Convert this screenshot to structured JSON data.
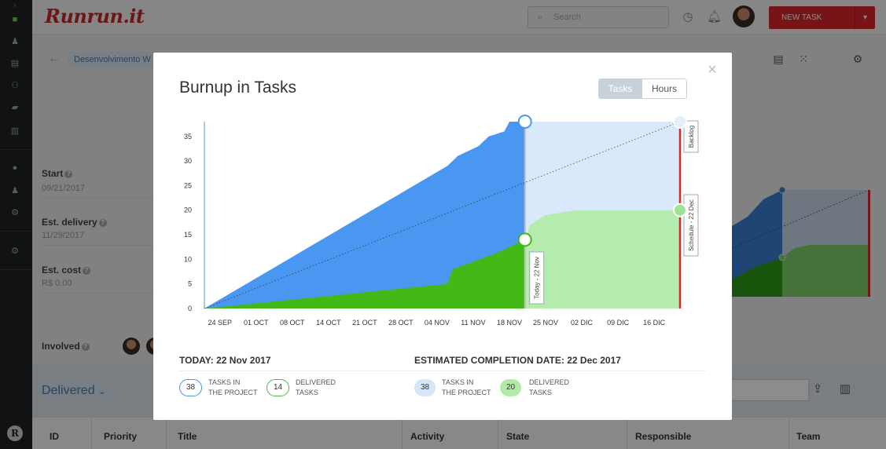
{
  "app": {
    "brand": "Runrun.it",
    "search_placeholder": "Search",
    "new_task_label": "NEW TASK"
  },
  "page": {
    "project_chip": "Desenvolvimento W",
    "start_label": "Start",
    "start_value": "09/21/2017",
    "est_delivery_label": "Est. delivery",
    "est_delivery_value": "11/29/2017",
    "est_cost_label": "Est. cost",
    "est_cost_value": "R$ 0.00",
    "involved_label": "Involved",
    "delivered_title": "Delivered",
    "table_headers": [
      "ID",
      "Priority",
      "Title",
      "Activity",
      "State",
      "Responsible",
      "Team"
    ]
  },
  "modal": {
    "title": "Burnup in Tasks",
    "toggle": {
      "tasks_label": "Tasks",
      "hours_label": "Hours",
      "selected": "Tasks"
    },
    "today_heading": "TODAY: 22 Nov 2017",
    "estimate_heading": "ESTIMATED COMPLETION DATE: 22 Dec 2017",
    "today_stats": [
      {
        "value": "38",
        "label_line1": "TASKS IN",
        "label_line2": "THE PROJECT"
      },
      {
        "value": "14",
        "label_line1": "DELIVERED",
        "label_line2": "TASKS"
      }
    ],
    "estimate_stats": [
      {
        "value": "38",
        "label_line1": "TASKS IN",
        "label_line2": "THE PROJECT"
      },
      {
        "value": "20",
        "label_line1": "DELIVERED",
        "label_line2": "TASKS"
      }
    ]
  },
  "chart_data": {
    "type": "area",
    "title": "Burnup in Tasks",
    "ylim": [
      0,
      38
    ],
    "yticks": [
      0,
      5,
      10,
      15,
      20,
      25,
      30,
      35
    ],
    "x_tick_labels": [
      "24 SEP",
      "01 OCT",
      "08 OCT",
      "14 OCT",
      "21 OCT",
      "28 OCT",
      "04 NOV",
      "11 NOV",
      "18 NOV",
      "25 NOV",
      "02 DIC",
      "09 DIC",
      "16 DIC"
    ],
    "x_start": "2017-09-21",
    "x_end": "2017-12-22",
    "markers": [
      {
        "date": "2017-11-22",
        "label": "Today - 22 Nov"
      },
      {
        "date": "2017-12-22",
        "label": "Schedule - 22 Dec"
      }
    ],
    "backlog_label": "Backlog",
    "colors": {
      "scope": "#4a97f2",
      "delivered": "#43b917",
      "scope_projection": "#d9e9fb",
      "delivered_projection": "#b3ecac",
      "deadline": "#d9262c"
    },
    "series": [
      {
        "name": "Tasks in the project",
        "points": [
          [
            "2017-09-21",
            0
          ],
          [
            "2017-11-07",
            29
          ],
          [
            "2017-11-09",
            31
          ],
          [
            "2017-11-13",
            33
          ],
          [
            "2017-11-15",
            35
          ],
          [
            "2017-11-18",
            36
          ],
          [
            "2017-11-19",
            38
          ],
          [
            "2017-11-22",
            38
          ]
        ]
      },
      {
        "name": "Delivered tasks",
        "points": [
          [
            "2017-09-21",
            0
          ],
          [
            "2017-11-07",
            5
          ],
          [
            "2017-11-08",
            8
          ],
          [
            "2017-11-12",
            9.5
          ],
          [
            "2017-11-17",
            11.5
          ],
          [
            "2017-11-20",
            13
          ],
          [
            "2017-11-22",
            14
          ]
        ]
      },
      {
        "name": "Tasks in the project (projection)",
        "points": [
          [
            "2017-11-22",
            38
          ],
          [
            "2017-12-22",
            38
          ]
        ]
      },
      {
        "name": "Delivered tasks (projection)",
        "points": [
          [
            "2017-11-22",
            14
          ],
          [
            "2017-11-23",
            17
          ],
          [
            "2017-11-26",
            19
          ],
          [
            "2017-11-29",
            19.5
          ],
          [
            "2017-12-02",
            20
          ],
          [
            "2017-12-22",
            20
          ]
        ]
      }
    ]
  }
}
